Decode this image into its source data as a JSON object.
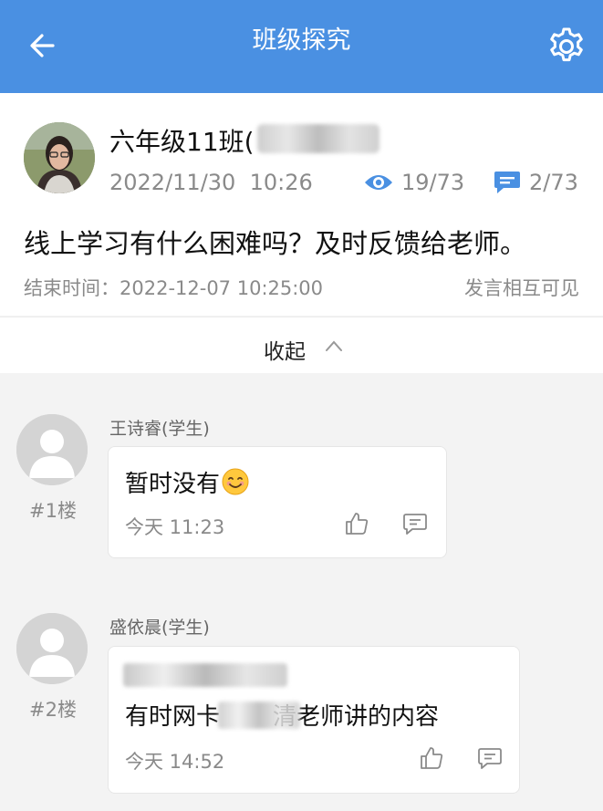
{
  "header": {
    "title": "班级探究"
  },
  "post": {
    "owner": "六年级11班(",
    "date": "2022/11/30",
    "time": "10:26",
    "views": "19/73",
    "replies": "2/73",
    "question": "线上学习有什么困难吗？及时反馈给老师。",
    "end_time": "结束时间：2022-12-07 10:25:00",
    "visibility": "发言相互可见"
  },
  "collapse": {
    "label": "收起"
  },
  "comments": [
    {
      "floor": "#1楼",
      "name": "王诗睿(学生)",
      "text": "暂时没有",
      "time": "今天  11:23"
    },
    {
      "floor": "#2楼",
      "name": "盛依晨(学生)",
      "text_a": "有时网卡",
      "text_b": "清老师讲的内容",
      "time": "今天  14:52"
    }
  ],
  "icons": {
    "back": "arrow-left-icon",
    "settings": "gear-icon",
    "views": "eye-icon",
    "replies": "chat-bubble-icon",
    "like": "thumbs-up-icon",
    "comment": "comment-icon",
    "emoji": "smiling-face-emoji"
  },
  "colors": {
    "header": "#4a90e2",
    "accent": "#4a90e2",
    "muted": "#8a8a8a"
  }
}
